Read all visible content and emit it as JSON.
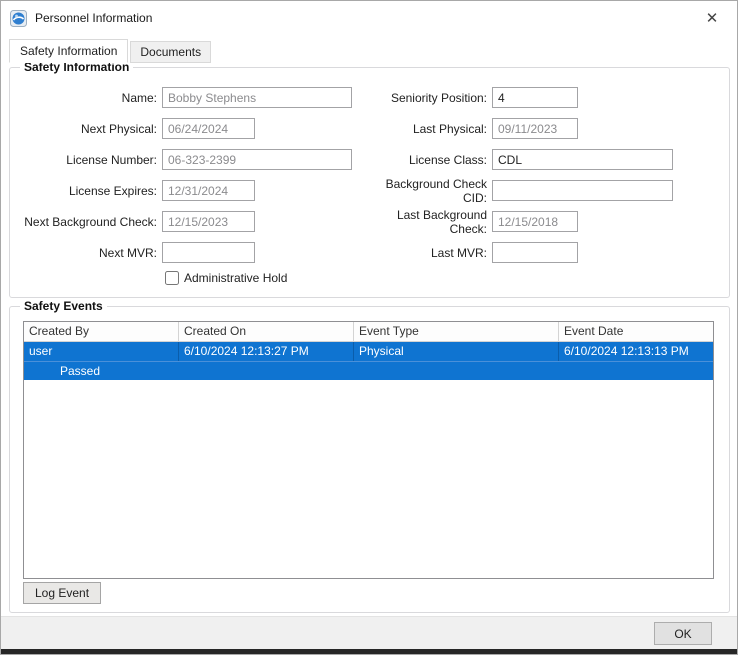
{
  "window": {
    "title": "Personnel Information",
    "close_glyph": "✕"
  },
  "tabs": [
    {
      "label": "Safety Information"
    },
    {
      "label": "Documents"
    }
  ],
  "safety_info": {
    "group_title": "Safety Information",
    "fields": {
      "name": {
        "label": "Name:",
        "value": "Bobby Stephens"
      },
      "seniority_position": {
        "label": "Seniority Position:",
        "value": "4"
      },
      "next_physical": {
        "label": "Next Physical:",
        "value": "06/24/2024"
      },
      "last_physical": {
        "label": "Last Physical:",
        "value": "09/11/2023"
      },
      "license_number": {
        "label": "License Number:",
        "value": "06-323-2399"
      },
      "license_class": {
        "label": "License Class:",
        "value": "CDL"
      },
      "license_expires": {
        "label": "License Expires:",
        "value": "12/31/2024"
      },
      "background_check_cid": {
        "label": "Background Check CID:",
        "value": ""
      },
      "next_background_check": {
        "label": "Next Background Check:",
        "value": "12/15/2023"
      },
      "last_background_check": {
        "label": "Last Background Check:",
        "value": "12/15/2018"
      },
      "next_mvr": {
        "label": "Next MVR:",
        "value": ""
      },
      "last_mvr": {
        "label": "Last MVR:",
        "value": ""
      }
    },
    "admin_hold_label": "Administrative Hold",
    "admin_hold_checked": false
  },
  "safety_events": {
    "group_title": "Safety Events",
    "columns": [
      "Created By",
      "Created On",
      "Event Type",
      "Event Date"
    ],
    "rows": [
      {
        "created_by": "user",
        "created_on": "6/10/2024 12:13:27 PM",
        "event_type": "Physical",
        "event_date": "6/10/2024 12:13:13 PM",
        "detail": "Passed",
        "selected": true
      }
    ],
    "log_event_label": "Log Event"
  },
  "footer": {
    "ok_label": "OK"
  },
  "colors": {
    "selection": "#0f74d1"
  }
}
